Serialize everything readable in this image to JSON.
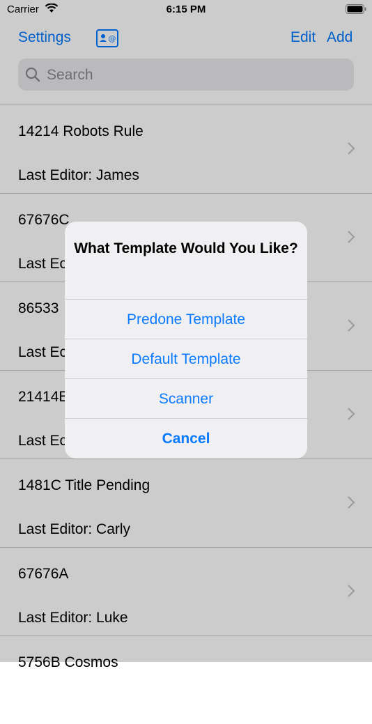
{
  "status_bar": {
    "carrier": "Carrier",
    "time": "6:15 PM"
  },
  "nav": {
    "settings_label": "Settings",
    "contact_icon": "contact-card-icon",
    "edit_label": "Edit",
    "add_label": "Add"
  },
  "search": {
    "placeholder": "Search"
  },
  "list": [
    {
      "title": "14214 Robots Rule",
      "subtitle": "Last Editor: James"
    },
    {
      "title": "67676C",
      "subtitle": "Last Ec"
    },
    {
      "title": "86533",
      "subtitle": "Last Ec"
    },
    {
      "title": "21414E",
      "subtitle": "Last Ec"
    },
    {
      "title": "1481C Title Pending",
      "subtitle": "Last Editor: Carly"
    },
    {
      "title": "67676A",
      "subtitle": "Last Editor: Luke"
    },
    {
      "title": "5756B Cosmos",
      "subtitle": ""
    }
  ],
  "alert": {
    "title": "What Template Would You Like?",
    "buttons": [
      "Predone Template",
      "Default Template",
      "Scanner"
    ],
    "cancel_label": "Cancel"
  },
  "colors": {
    "accent": "#007aff",
    "separator": "#c8c8cc",
    "overlay": "rgba(0,0,0,0.2)",
    "alert_bg": "#f0f0f2"
  }
}
